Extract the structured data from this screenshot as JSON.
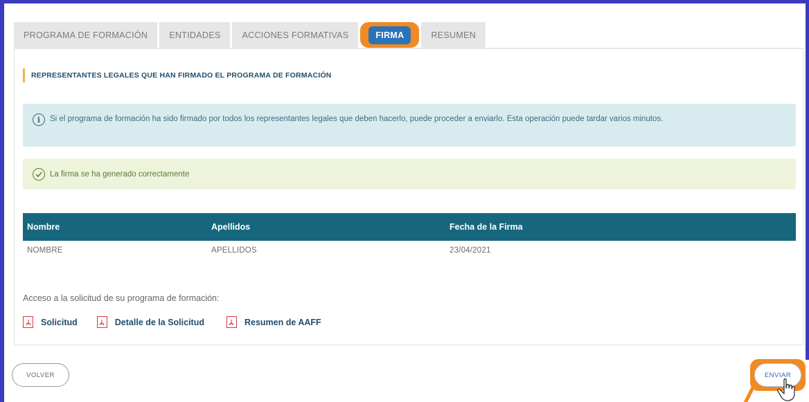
{
  "tabs": [
    {
      "label": "PROGRAMA DE FORMACIÓN"
    },
    {
      "label": "ENTIDADES"
    },
    {
      "label": "ACCIONES FORMATIVAS"
    },
    {
      "label": "FIRMA"
    },
    {
      "label": "RESUMEN"
    }
  ],
  "active_tab": "FIRMA",
  "section": {
    "title": "REPRESENTANTES LEGALES QUE HAN FIRMADO EL PROGRAMA DE FORMACIÓN"
  },
  "info": {
    "icon": "info-icon",
    "text": "Si el programa de formación ha sido firmado por todos los representantes legales que deben hacerlo, puede proceder a enviarlo. Esta operación puede tardar varios minutos."
  },
  "success": {
    "icon": "check-circle-icon",
    "text": "La firma se ha generado correctamente"
  },
  "table": {
    "headers": [
      "Nombre",
      "Apellidos",
      "Fecha de la Firma"
    ],
    "rows": [
      [
        "NOMBRE",
        "APELLIDOS",
        "23/04/2021"
      ]
    ]
  },
  "access": {
    "label": "Acceso a la solicitud de su programa de formación:",
    "links": [
      {
        "label": "Solicitud",
        "icon": "pdf-icon"
      },
      {
        "label": "Detalle de la Solicitud",
        "icon": "pdf-icon"
      },
      {
        "label": "Resumen de AAFF",
        "icon": "pdf-icon"
      }
    ]
  },
  "buttons": {
    "back": "VOLVER",
    "send": "ENVIAR"
  },
  "colors": {
    "frame": "#3b3bc0",
    "highlight": "#f08a24",
    "active_tab": "#2b73b8",
    "table_header": "#16677d",
    "info_bg": "#d8ecf0",
    "success_bg": "#eef4dc",
    "pdf_red": "#d9333f"
  }
}
